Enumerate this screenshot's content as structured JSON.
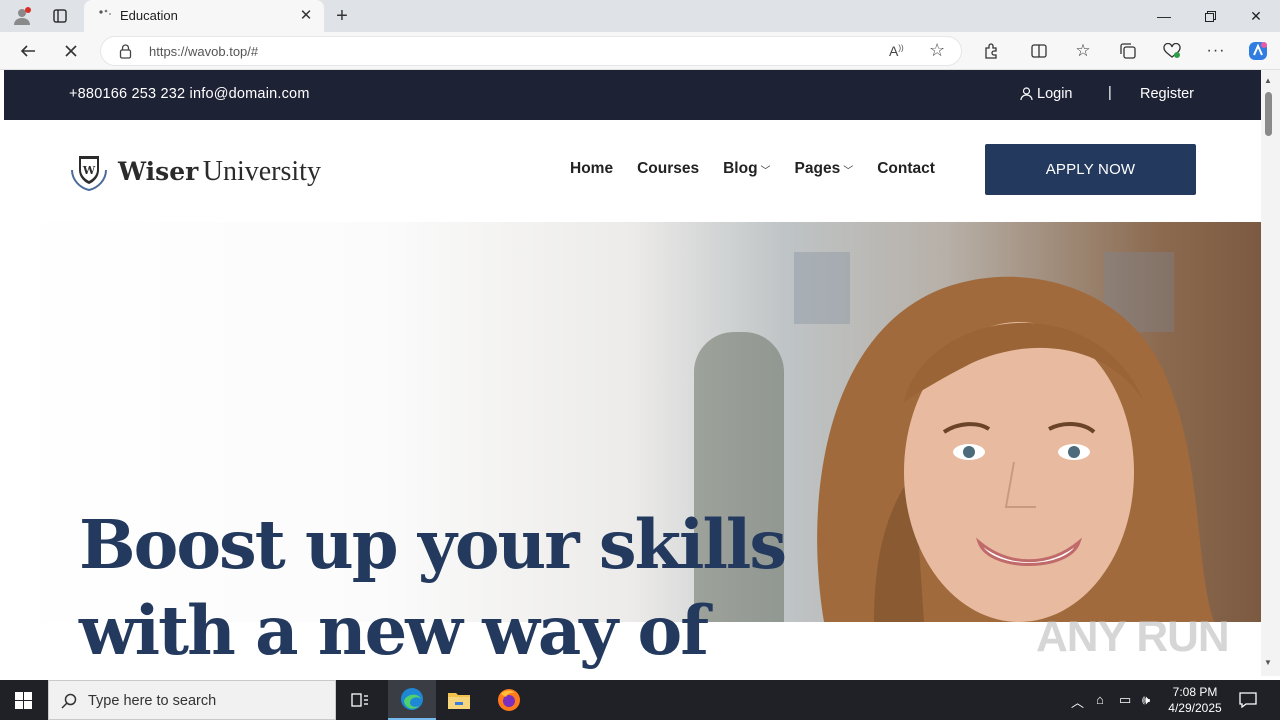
{
  "browser": {
    "tab_title": "Education",
    "url": "https://wavob.top/#",
    "icons": [
      "profile-icon",
      "tab-actions-icon",
      "close-icon",
      "new-tab-icon",
      "minimize-icon",
      "restore-icon",
      "back-icon",
      "stop-icon",
      "lock-icon",
      "read-aloud-icon",
      "favorite-icon",
      "extensions-icon",
      "split-screen-icon",
      "favorites-icon",
      "collections-icon",
      "performance-icon",
      "more-icon",
      "copilot-icon"
    ]
  },
  "site": {
    "topbar": {
      "contact": "+880166 253 232 info@domain.com",
      "login": "Login",
      "separator": "|",
      "register": "Register"
    },
    "logo": {
      "bold": "Wiser",
      "rest": "University",
      "badge_letter": "W"
    },
    "nav": [
      {
        "label": "Home"
      },
      {
        "label": "Courses"
      },
      {
        "label": "Blog"
      },
      {
        "label": "Pages"
      },
      {
        "label": "Contact"
      }
    ],
    "cta": "APPLY NOW",
    "hero": {
      "title_line1": "Boost up your skills",
      "title_line2": "with a new way of"
    },
    "colors": {
      "topbar": "#1e2235",
      "accent": "#233a5e"
    }
  },
  "watermark": "ANY RUN",
  "taskbar": {
    "search_placeholder": "Type here to search",
    "time": "7:08 PM",
    "date": "4/29/2025",
    "icons": [
      "windows-start-icon",
      "search-icon",
      "task-view-icon",
      "edge-icon",
      "file-explorer-icon",
      "firefox-icon",
      "chevron-up-icon",
      "network-icon",
      "volume-icon",
      "notification-icon"
    ]
  }
}
